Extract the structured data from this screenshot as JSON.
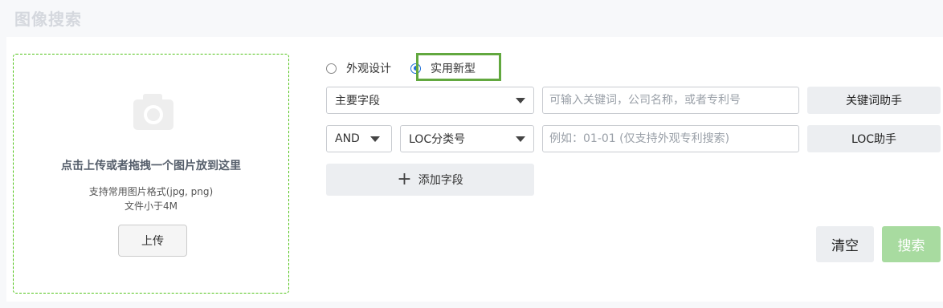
{
  "page": {
    "title": "图像搜索"
  },
  "upload": {
    "main_text": "点击上传或者拖拽一个图片放到这里",
    "format_hint": "支持常用图片格式(jpg, png)",
    "size_hint": "文件小于4M",
    "button_label": "上传",
    "icon": "camera-icon"
  },
  "patent_type": {
    "options": [
      {
        "label": "外观设计",
        "checked": false
      },
      {
        "label": "实用新型",
        "checked": true
      }
    ]
  },
  "row1": {
    "field_select": "主要字段",
    "input_placeholder": "可输入关键词，公司名称，或者专利号",
    "helper_button": "关键词助手"
  },
  "row2": {
    "operator_select": "AND",
    "field_select": "LOC分类号",
    "input_placeholder": "例如：01-01 (仅支持外观专利搜索)",
    "helper_button": "LOC助手"
  },
  "add_field": {
    "label": "添加字段",
    "icon": "plus-icon"
  },
  "actions": {
    "clear_label": "清空",
    "search_label": "搜索"
  },
  "colors": {
    "accent_blue": "#1e6fd9",
    "highlight_green": "#62a83f",
    "dashed_border": "#52c41a",
    "search_button": "#a8dba0"
  }
}
